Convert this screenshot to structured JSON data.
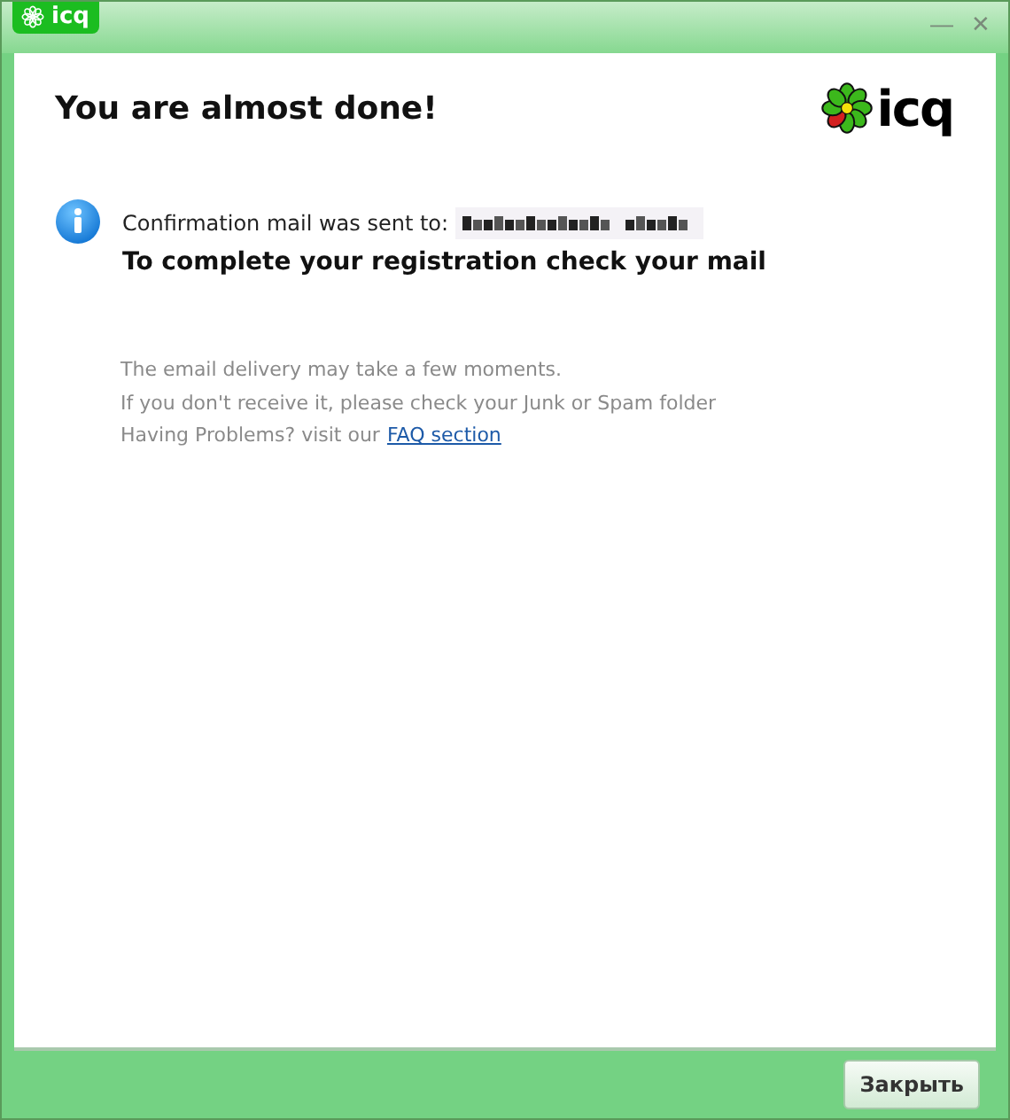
{
  "window": {
    "badge": "icq",
    "minimize": "—",
    "close": "✕"
  },
  "heading": "You are almost done!",
  "logo": {
    "text": "icq"
  },
  "info": {
    "sent_label": "Confirmation mail was sent to:",
    "instruction": "To complete your registration check your mail"
  },
  "notes": [
    "The email delivery may take a few moments.",
    "If you don't receive it, please check your Junk or Spam folder"
  ],
  "help": {
    "text": "Having Problems? visit our",
    "link": "FAQ section"
  },
  "buttons": [
    "Закрыть"
  ]
}
